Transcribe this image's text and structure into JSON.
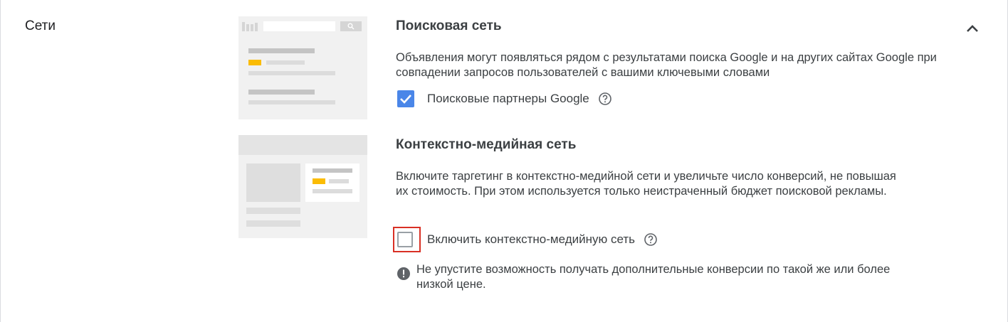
{
  "section": {
    "label": "Сети"
  },
  "search_network": {
    "title": "Поисковая сеть",
    "description": "Объявления могут появляться рядом с результатами поиска Google и на других сайтах Google при совпадении запросов пользователей с вашими ключевыми словами",
    "checkbox_label": "Поисковые партнеры Google",
    "checkbox_checked": true
  },
  "display_network": {
    "title": "Контекстно-медийная сеть",
    "description": "Включите таргетинг в контекстно-медийной сети и увеличьте число конверсий, не повышая их стоимость. При этом используется только неистраченный бюджет поисковой рекламы.",
    "checkbox_label": "Включить контекстно-медийную сеть",
    "checkbox_checked": false,
    "notice": "Не упустите возможность получать дополнительные конверсии по такой же или более низкой цене."
  },
  "colors": {
    "accent_blue": "#4a86e8",
    "highlight_red": "#d93025",
    "ad_yellow": "#fbbc04",
    "illustration_bg": "#f1f1f1"
  },
  "icons": {
    "collapse": "chevron-up-icon",
    "help": "help-circle-icon",
    "warning": "info-filled-icon",
    "checkmark": "check-icon"
  }
}
